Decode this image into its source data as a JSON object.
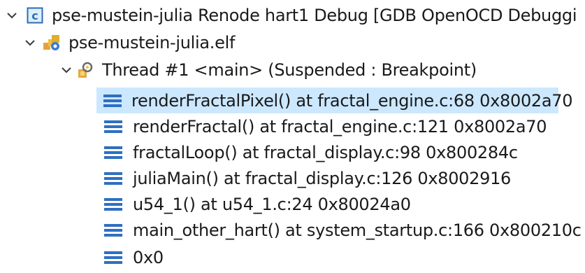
{
  "colors": {
    "selection": "#cce8ff",
    "frame_icon": "#2f6fc2",
    "chevron": "#3a3a3a",
    "launch_icon_border": "#2d6db5",
    "launch_icon_fill": "#dfeeff"
  },
  "tree": {
    "launch": {
      "icon": "c-launch-config-icon",
      "label": "pse-mustein-julia Renode hart1 Debug [GDB OpenOCD Debuggi"
    },
    "process": {
      "icon": "elf-process-icon",
      "label": "pse-mustein-julia.elf"
    },
    "thread": {
      "icon": "thread-suspended-icon",
      "label": "Thread #1 <main> (Suspended : Breakpoint)"
    },
    "frames": [
      {
        "icon": "stack-frame-icon",
        "label": "renderFractalPixel() at fractal_engine.c:68 0x8002a70",
        "selected": true
      },
      {
        "icon": "stack-frame-icon",
        "label": "renderFractal() at fractal_engine.c:121 0x8002a70",
        "selected": false
      },
      {
        "icon": "stack-frame-icon",
        "label": "fractalLoop() at fractal_display.c:98 0x800284c",
        "selected": false
      },
      {
        "icon": "stack-frame-icon",
        "label": "juliaMain() at fractal_display.c:126 0x8002916",
        "selected": false
      },
      {
        "icon": "stack-frame-icon",
        "label": "u54_1() at u54_1.c:24 0x80024a0",
        "selected": false
      },
      {
        "icon": "stack-frame-icon",
        "label": "main_other_hart() at system_startup.c:166 0x800210c",
        "selected": false
      },
      {
        "icon": "stack-frame-icon",
        "label": "0x0",
        "selected": false
      }
    ]
  }
}
